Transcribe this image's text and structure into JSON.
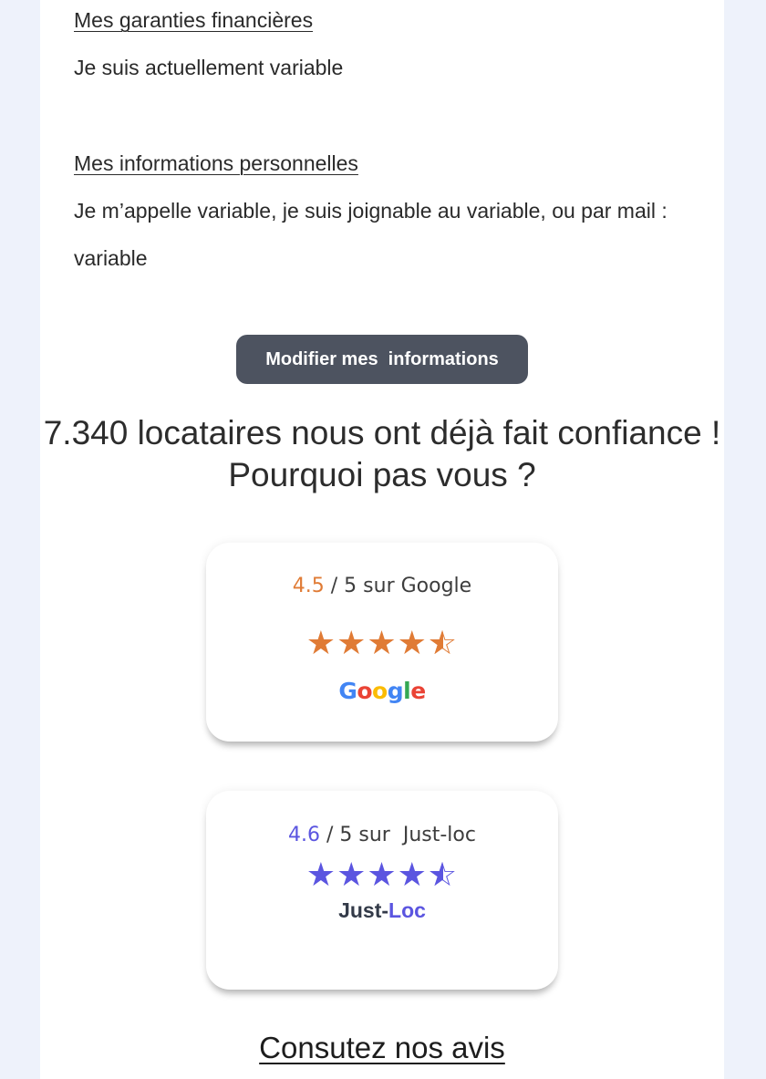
{
  "profile": {
    "financial_title": "Mes garanties financières",
    "financial_text": "Je suis actuellement variable",
    "personal_title": "Mes informations personnelles",
    "personal_text": "Je m’appelle variable, je suis joignable au variable, ou par mail : variable",
    "modify_button_label": "Modifier mes  informations"
  },
  "trust": {
    "headline": "7.340 locataires nous ont déjà fait confiance ! Pourquoi pas vous ?"
  },
  "ratings": {
    "google": {
      "score": "4.5",
      "suffix": " / 5 sur Google",
      "stars": 4.5,
      "logo_letters": [
        "G",
        "o",
        "o",
        "g",
        "l",
        "e"
      ],
      "color": "#e07b35"
    },
    "justloc": {
      "score": "4.6",
      "suffix": " / 5 sur  Just-loc",
      "stars": 4.5,
      "logo_part1": "Just-",
      "logo_part2": "Loc",
      "color": "#5b55e0"
    }
  },
  "reviews_link_label": "Consutez nos avis",
  "colors": {
    "page_background": "#eef2fb",
    "button_background": "#4d5360",
    "google_orange": "#e07b35",
    "justloc_purple": "#5b55e0"
  }
}
